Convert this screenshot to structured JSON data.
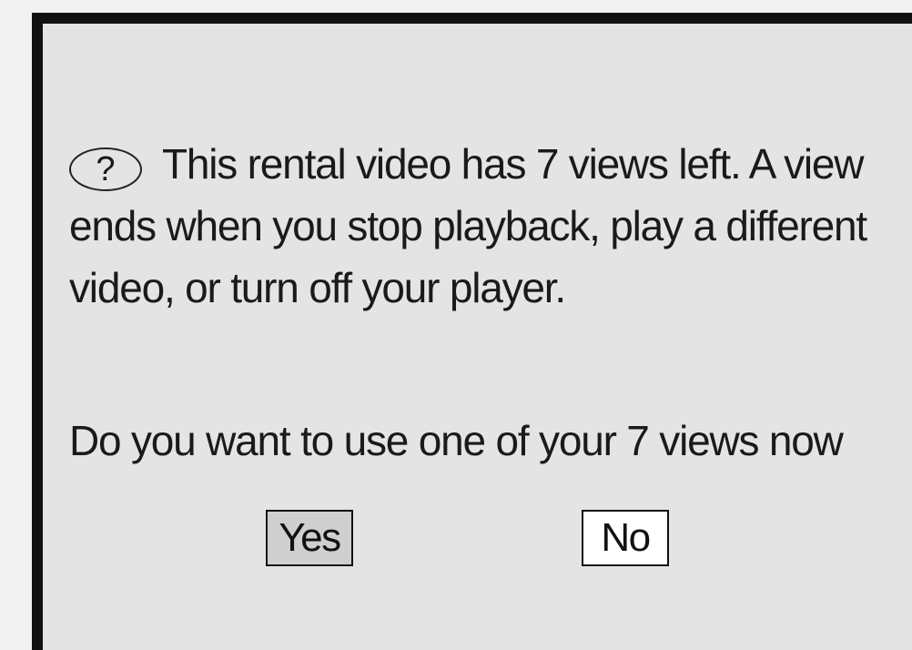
{
  "dialog": {
    "icon": "question-icon",
    "icon_glyph": "?",
    "message": "This rental video has 7 views left. A view ends when you stop playback, play a different video, or turn off your player.",
    "prompt": "Do you want to use one of your 7 views now",
    "buttons": {
      "yes_label": "Yes",
      "no_label": "No"
    },
    "selected_button": "Yes"
  },
  "colors": {
    "background": "#e4e4e4",
    "border": "#111111",
    "selected_button": "#cfcfcf",
    "unselected_button": "#ffffff"
  }
}
